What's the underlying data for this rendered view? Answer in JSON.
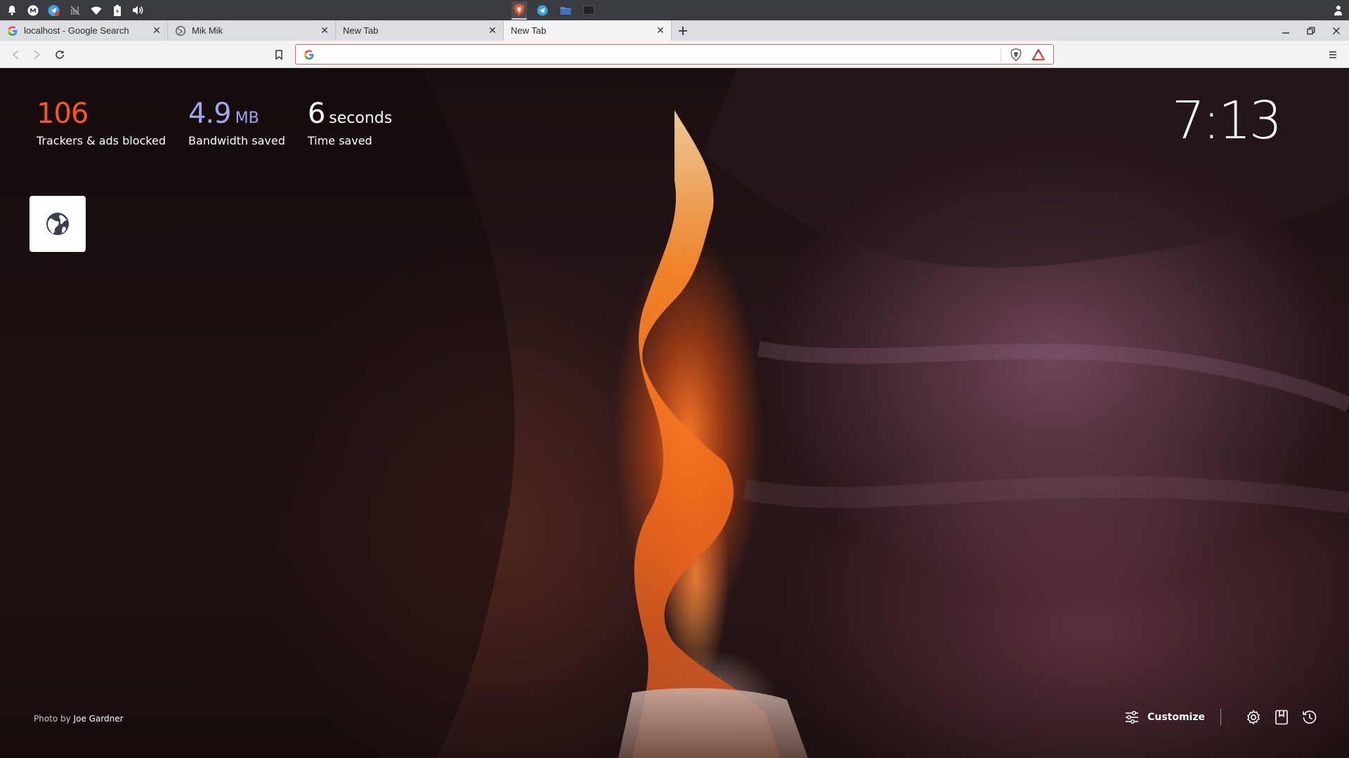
{
  "system_bar": {
    "left_icons": [
      "bell-icon",
      "mail-icon",
      "telegram-icon",
      "network-off-icon",
      "wifi-icon",
      "battery-icon",
      "volume-icon"
    ],
    "task_icons": [
      "brave-task-icon",
      "telegram-task-icon",
      "folder-task-icon",
      "terminal-task-icon"
    ],
    "right_icons": [
      "user-icon"
    ]
  },
  "tabs": [
    {
      "title": "localhost - Google Search",
      "favicon": "google-favicon"
    },
    {
      "title": "Mik Mik",
      "favicon": "globe-favicon"
    },
    {
      "title": "New Tab",
      "favicon": "none"
    },
    {
      "title": "New Tab",
      "favicon": "none",
      "active": true
    }
  ],
  "toolbar": {
    "url_value": "",
    "url_placeholder": ""
  },
  "stats": {
    "trackers": {
      "value": "106",
      "label": "Trackers & ads blocked"
    },
    "bandwidth": {
      "value": "4.9",
      "unit": "MB",
      "label": "Bandwidth saved"
    },
    "time": {
      "value": "6",
      "unit": "seconds",
      "label": "Time saved"
    }
  },
  "clock": "7:13",
  "photo_credit": {
    "prefix": "Photo by",
    "author": "Joe Gardner"
  },
  "actions": {
    "customize_label": "Customize"
  },
  "colors": {
    "trackers": "#fb542b",
    "bandwidth": "#a0a5eb",
    "urlbar_border": "#e8644c",
    "system_bar": "#383c40",
    "tab_strip": "#dcdde0"
  }
}
